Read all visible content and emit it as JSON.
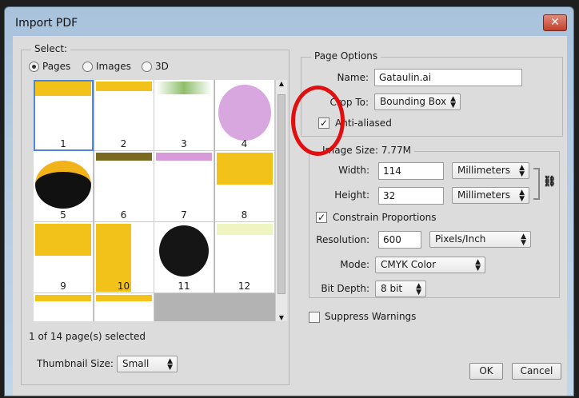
{
  "window": {
    "title": "Import PDF",
    "close": "✕"
  },
  "select": {
    "label": "Select:",
    "radios": [
      {
        "label": "Pages",
        "on": true
      },
      {
        "label": "Images",
        "on": false
      },
      {
        "label": "3D",
        "on": false
      }
    ],
    "pages": [
      "1",
      "2",
      "3",
      "4",
      "5",
      "6",
      "7",
      "8",
      "9",
      "10",
      "11",
      "12"
    ],
    "status": "1 of 14 page(s) selected",
    "thumb_label": "Thumbnail Size:",
    "thumb_value": "Small"
  },
  "page_options": {
    "label": "Page Options",
    "name_label": "Name:",
    "name_value": "Gataulin.ai",
    "crop_label": "Crop To:",
    "crop_value": "Bounding Box",
    "anti_label": "Anti-aliased",
    "anti_checked": true
  },
  "image_size": {
    "label": "Image Size: 7.77M",
    "width_label": "Width:",
    "width_value": "114",
    "width_unit": "Millimeters",
    "height_label": "Height:",
    "height_value": "32",
    "height_unit": "Millimeters",
    "constrain_label": "Constrain Proportions",
    "res_label": "Resolution:",
    "res_value": "600",
    "res_unit": "Pixels/Inch",
    "mode_label": "Mode:",
    "mode_value": "CMYK Color",
    "depth_label": "Bit Depth:",
    "depth_value": "8 bit"
  },
  "suppress_label": "Suppress Warnings",
  "buttons": {
    "ok": "OK",
    "cancel": "Cancel"
  },
  "colors": {
    "annotation": "#e01010",
    "selection": "#4f86d6",
    "label_yellow": "#f2c21a"
  }
}
